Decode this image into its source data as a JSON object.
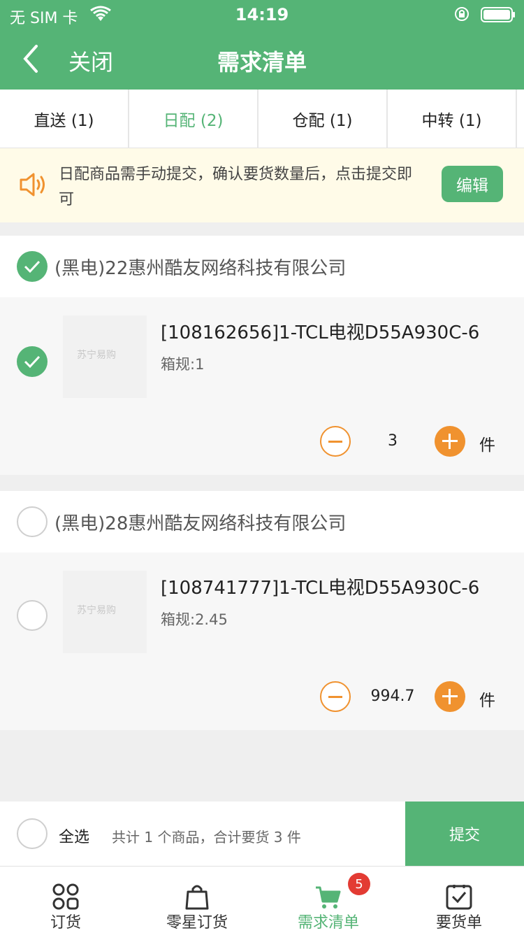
{
  "status_bar": {
    "carrier": "无 SIM 卡",
    "time": "14:19"
  },
  "nav": {
    "close": "关闭",
    "title": "需求清单"
  },
  "tabs": [
    {
      "label": "直送 (1)",
      "active": false
    },
    {
      "label": "日配 (2)",
      "active": true
    },
    {
      "label": "仓配 (1)",
      "active": false
    },
    {
      "label": "中转 (1)",
      "active": false
    }
  ],
  "notice": {
    "text": "日配商品需手动提交，确认要货数量后，点击提交即可",
    "edit": "编辑"
  },
  "groups": [
    {
      "store": "(黑电)22惠州酷友网络科技有限公司",
      "checked": true,
      "item": {
        "name": "[108162656]1-TCL电视D55A930C-6",
        "spec": "箱规:1",
        "qty": "3",
        "unit": "件",
        "checked": true,
        "logo": "苏宁易购"
      }
    },
    {
      "store": "(黑电)28惠州酷友网络科技有限公司",
      "checked": false,
      "item": {
        "name": "[108741777]1-TCL电视D55A930C-6",
        "spec": "箱规:2.45",
        "qty": "994.7",
        "unit": "件",
        "checked": false,
        "logo": "苏宁易购"
      }
    }
  ],
  "footer": {
    "select_all": "全选",
    "summary": "共计 1 个商品，合计要货 3 件",
    "submit": "提交"
  },
  "tabbar": [
    {
      "label": "订货",
      "icon": "grid-icon",
      "active": false
    },
    {
      "label": "零星订货",
      "icon": "bag-icon",
      "active": false
    },
    {
      "label": "需求清单",
      "icon": "cart-icon",
      "active": true,
      "badge": "5"
    },
    {
      "label": "要货单",
      "icon": "checklist-icon",
      "active": false
    }
  ],
  "colors": {
    "primary": "#55b476",
    "accent": "#f0922f",
    "badge": "#e33b33",
    "notice_bg": "#fffbe8"
  }
}
